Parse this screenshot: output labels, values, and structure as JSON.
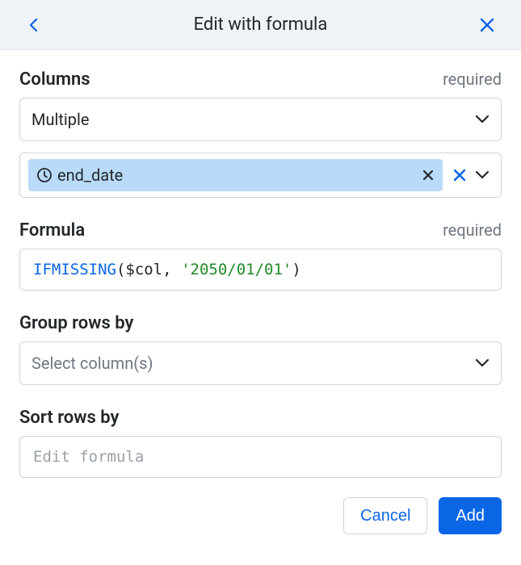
{
  "header": {
    "title": "Edit with formula"
  },
  "columns": {
    "label": "Columns",
    "required_text": "required",
    "selector_value": "Multiple",
    "selected_chip": {
      "icon_name": "clock-icon",
      "label": "end_date"
    }
  },
  "formula": {
    "label": "Formula",
    "required_text": "required",
    "tokens": {
      "fn": "IFMISSING",
      "open": "(",
      "var": "$col",
      "comma": ", ",
      "str": "'2050/01/01'",
      "close": ")"
    }
  },
  "group_by": {
    "label": "Group rows by",
    "placeholder": "Select column(s)"
  },
  "sort_by": {
    "label": "Sort rows by",
    "placeholder": "Edit formula"
  },
  "footer": {
    "cancel": "Cancel",
    "add": "Add"
  }
}
